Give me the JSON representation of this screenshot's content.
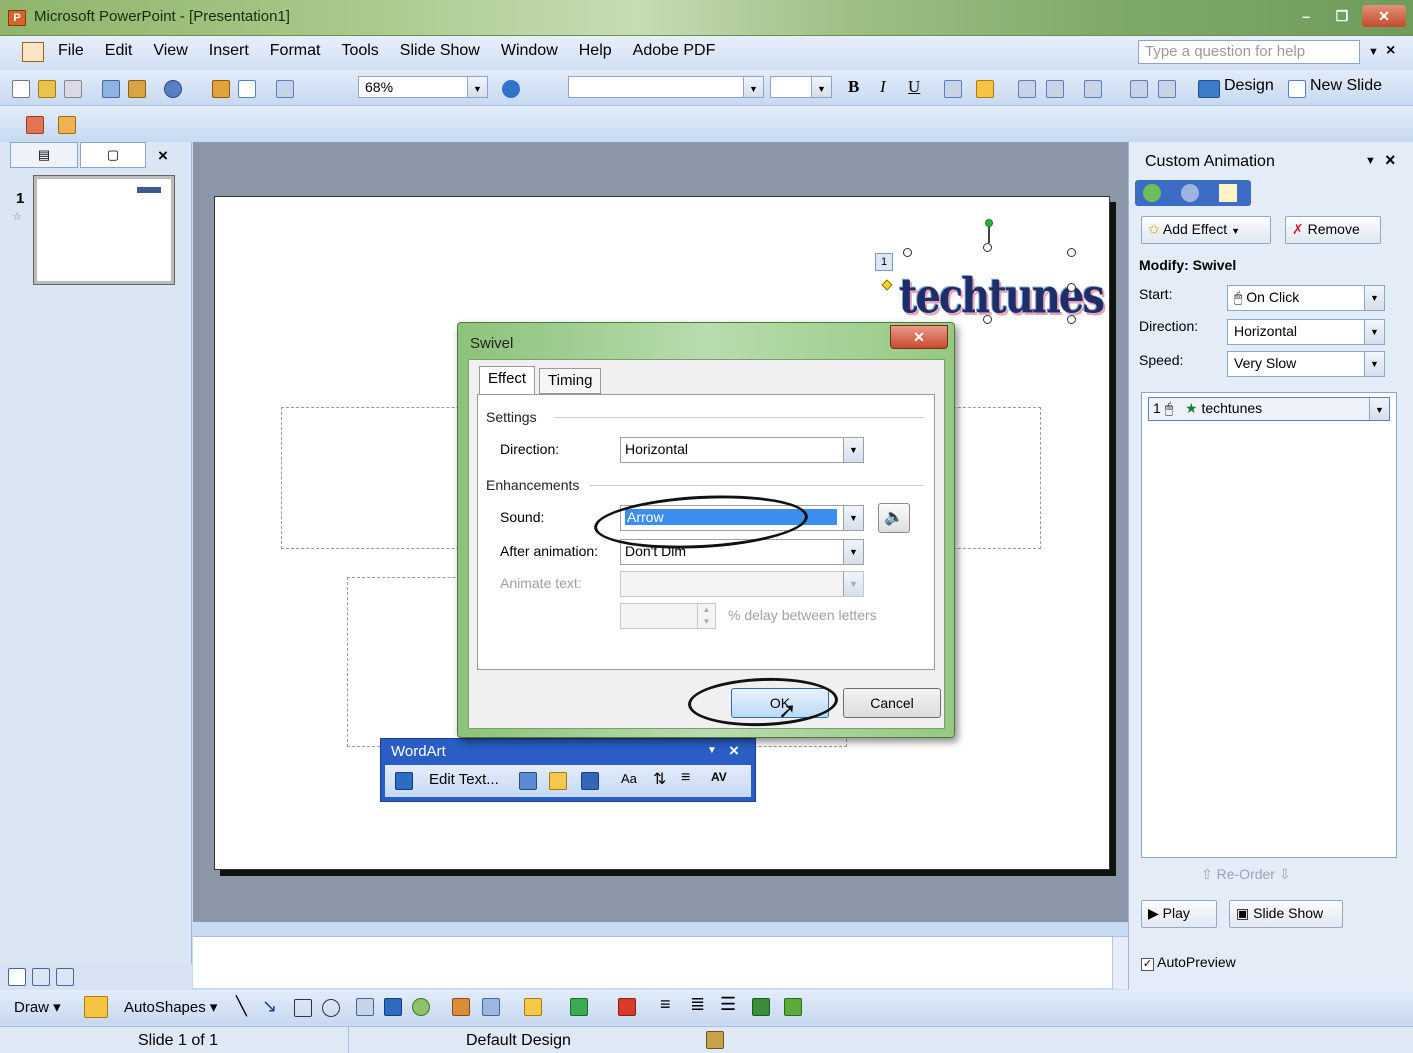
{
  "window": {
    "title": "Microsoft PowerPoint - [Presentation1]",
    "minimize": "–",
    "restore": "❐",
    "close": "✕"
  },
  "menu": {
    "items": [
      "File",
      "Edit",
      "View",
      "Insert",
      "Format",
      "Tools",
      "Slide Show",
      "Window",
      "Help",
      "Adobe PDF"
    ],
    "help_placeholder": "Type a question for help",
    "close_doc": "×"
  },
  "toolbar": {
    "zoom": "68%",
    "bold": "B",
    "italic": "I",
    "underline": "U",
    "design": "Design",
    "new_slide": "New Slide"
  },
  "left_pane": {
    "slide_number": "1",
    "close": "×"
  },
  "slide": {
    "wordart_text": "techtunes",
    "anim_marker": "1"
  },
  "dialog": {
    "title": "Swivel",
    "close": "✕",
    "tabs": [
      "Effect",
      "Timing"
    ],
    "settings_group": "Settings",
    "direction_label": "Direction:",
    "direction_value": "Horizontal",
    "enhancements_group": "Enhancements",
    "sound_label": "Sound:",
    "sound_value": "Arrow",
    "after_animation_label": "After animation:",
    "after_animation_value": "Don't Dim",
    "animate_text_label": "Animate text:",
    "delay_label": "% delay between letters",
    "ok": "OK",
    "cancel": "Cancel"
  },
  "wordart_toolbar": {
    "title": "WordArt",
    "edit_text": "Edit Text...",
    "close": "×"
  },
  "task_pane": {
    "title": "Custom Animation",
    "add_effect": "Add Effect",
    "remove": "Remove",
    "modify_heading": "Modify: Swivel",
    "start_label": "Start:",
    "start_value": "On Click",
    "direction_label": "Direction:",
    "direction_value": "Horizontal",
    "speed_label": "Speed:",
    "speed_value": "Very Slow",
    "list_item_index": "1",
    "list_item_name": "techtunes",
    "reorder": "Re-Order",
    "play": "Play",
    "slide_show": "Slide Show",
    "autopreview": "AutoPreview"
  },
  "draw_toolbar": {
    "draw": "Draw",
    "autoshapes": "AutoShapes"
  },
  "status": {
    "slide": "Slide 1 of 1",
    "design": "Default Design"
  },
  "colors": {
    "dialog_frame": "#95c981",
    "selection_blue": "#3b8df0",
    "wordart_bar": "#2a5ec4"
  }
}
